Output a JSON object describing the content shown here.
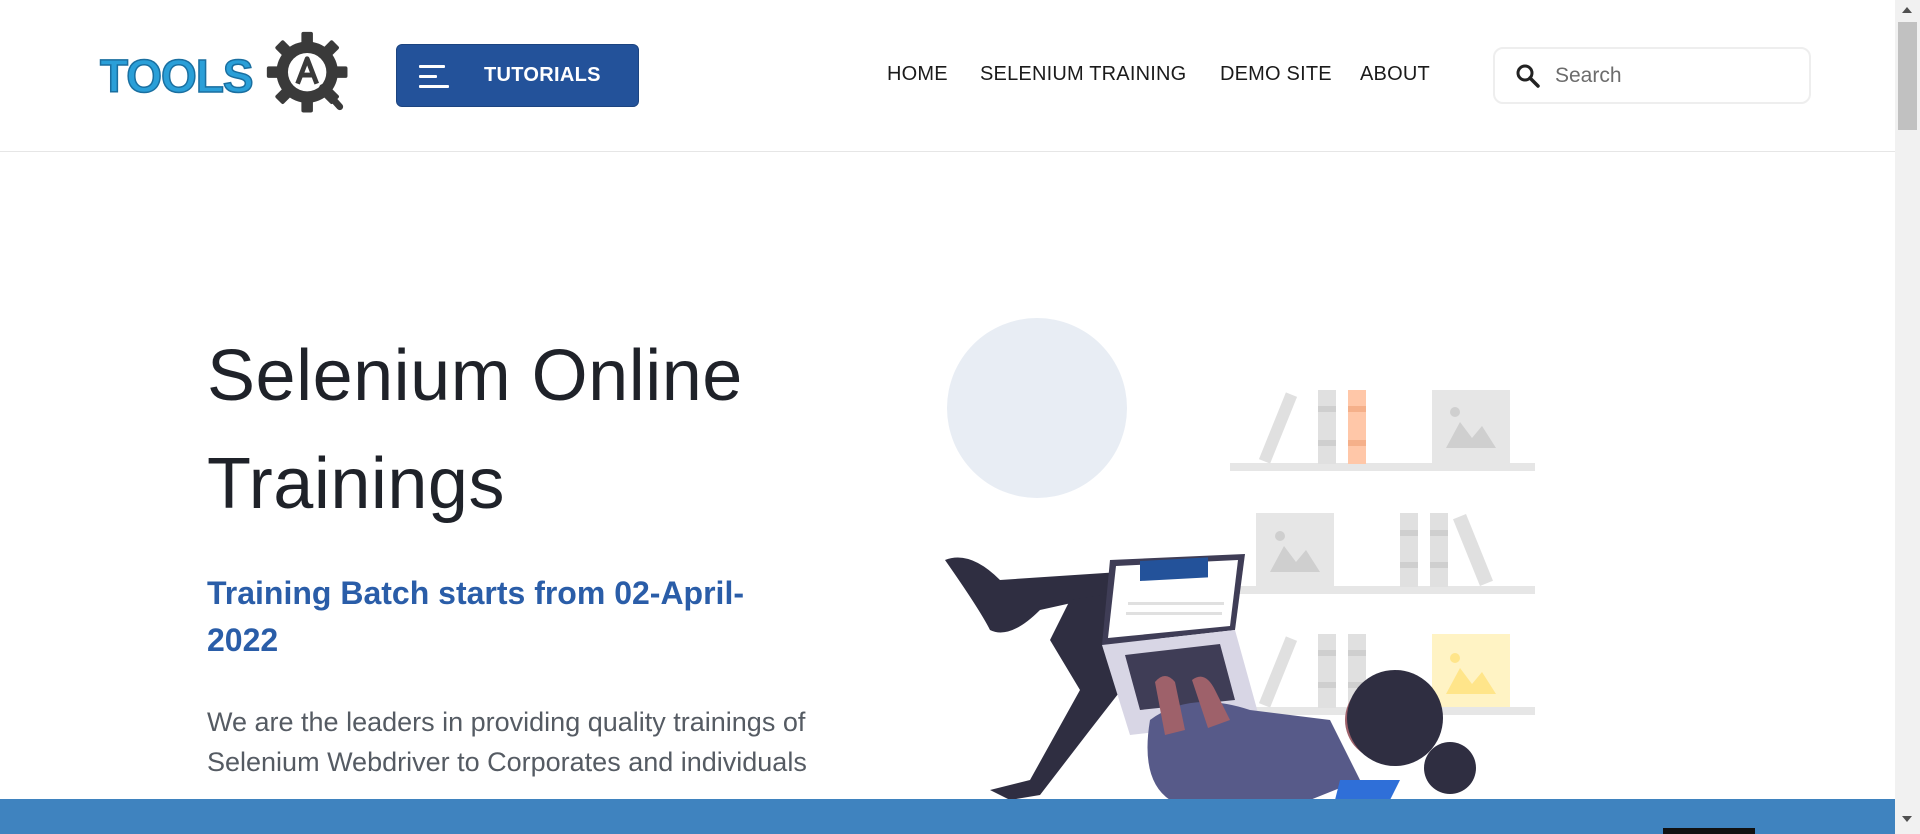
{
  "header": {
    "logo_text": "TOOLS",
    "logo_gear_letter": "A",
    "tutorials_label": "TUTORIALS",
    "nav": [
      {
        "label": "HOME"
      },
      {
        "label": "SELENIUM TRAINING"
      },
      {
        "label": "DEMO SITE"
      },
      {
        "label": "ABOUT"
      }
    ],
    "search": {
      "placeholder": "Search",
      "value": ""
    }
  },
  "hero": {
    "title_line1": "Selenium Online",
    "title_line2": "Trainings",
    "subtitle": "Training Batch starts from 02-April-2022",
    "description": "We are the leaders in providing quality trainings of Selenium Webdriver to Corporates and individuals"
  },
  "colors": {
    "brand_blue": "#23529a",
    "logo_blue": "#2a9fd8",
    "subtitle_blue": "#2a5da8",
    "bottom_bar": "#3f83bf"
  },
  "icons": {
    "menu": "hamburger-icon",
    "search": "search-icon",
    "logo": "gear-icon"
  }
}
